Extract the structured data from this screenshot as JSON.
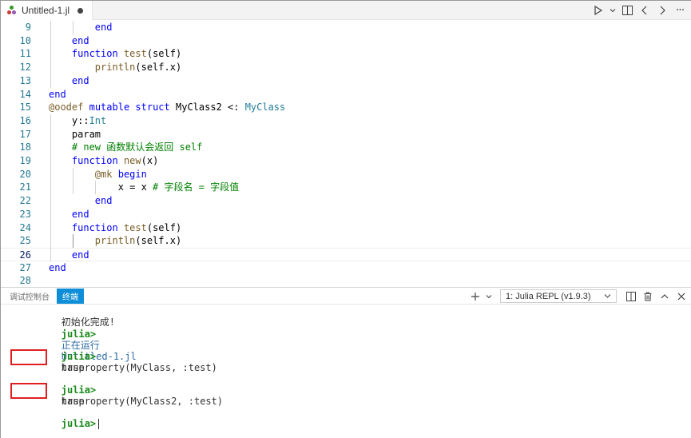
{
  "tab": {
    "filename": "Untitled-1.jl"
  },
  "editor": {
    "lines": [
      {
        "num": "9",
        "segments": [
          {
            "t": "        "
          },
          {
            "t": "end",
            "c": "kw"
          }
        ]
      },
      {
        "num": "10",
        "segments": [
          {
            "t": "    "
          },
          {
            "t": "end",
            "c": "kw"
          }
        ]
      },
      {
        "num": "11",
        "segments": [
          {
            "t": "    "
          },
          {
            "t": "function",
            "c": "kw"
          },
          {
            "t": " "
          },
          {
            "t": "test",
            "c": "fn"
          },
          {
            "t": "(self)"
          }
        ]
      },
      {
        "num": "12",
        "segments": [
          {
            "t": "        "
          },
          {
            "t": "println",
            "c": "fn"
          },
          {
            "t": "(self.x)"
          }
        ]
      },
      {
        "num": "13",
        "segments": [
          {
            "t": "    "
          },
          {
            "t": "end",
            "c": "kw"
          }
        ]
      },
      {
        "num": "14",
        "segments": [
          {
            "t": "end",
            "c": "kw"
          }
        ]
      },
      {
        "num": "15",
        "segments": [
          {
            "t": "@oodef",
            "c": "mc"
          },
          {
            "t": " "
          },
          {
            "t": "mutable",
            "c": "kw"
          },
          {
            "t": " "
          },
          {
            "t": "struct",
            "c": "kw"
          },
          {
            "t": " MyClass2 <: "
          },
          {
            "t": "MyClass",
            "c": "ty"
          }
        ]
      },
      {
        "num": "16",
        "segments": [
          {
            "t": "    y::"
          },
          {
            "t": "Int",
            "c": "ty"
          }
        ]
      },
      {
        "num": "17",
        "segments": [
          {
            "t": "    param"
          }
        ]
      },
      {
        "num": "18",
        "segments": [
          {
            "t": "    "
          },
          {
            "t": "# new 函数默认会返回 self",
            "c": "cm"
          }
        ]
      },
      {
        "num": "19",
        "segments": [
          {
            "t": "    "
          },
          {
            "t": "function",
            "c": "kw"
          },
          {
            "t": " "
          },
          {
            "t": "new",
            "c": "fn"
          },
          {
            "t": "(x)"
          }
        ]
      },
      {
        "num": "20",
        "segments": [
          {
            "t": "        "
          },
          {
            "t": "@mk",
            "c": "mc"
          },
          {
            "t": " "
          },
          {
            "t": "begin",
            "c": "kw"
          }
        ]
      },
      {
        "num": "21",
        "segments": [
          {
            "t": "            x = x "
          },
          {
            "t": "# 字段名 = 字段值",
            "c": "cm"
          }
        ]
      },
      {
        "num": "22",
        "segments": [
          {
            "t": "        "
          },
          {
            "t": "end",
            "c": "kw"
          }
        ]
      },
      {
        "num": "23",
        "segments": [
          {
            "t": "    "
          },
          {
            "t": "end",
            "c": "kw"
          }
        ]
      },
      {
        "num": "24",
        "segments": [
          {
            "t": "    "
          },
          {
            "t": "function",
            "c": "kw"
          },
          {
            "t": " "
          },
          {
            "t": "test",
            "c": "fn"
          },
          {
            "t": "(self)"
          }
        ]
      },
      {
        "num": "25",
        "segments": [
          {
            "t": "        "
          },
          {
            "t": "println",
            "c": "fn"
          },
          {
            "t": "(self.x)"
          }
        ]
      },
      {
        "num": "26",
        "segments": [
          {
            "t": "    "
          },
          {
            "t": "end",
            "c": "kw"
          }
        ]
      },
      {
        "num": "27",
        "segments": [
          {
            "t": "end",
            "c": "kw"
          }
        ]
      },
      {
        "num": "28",
        "segments": []
      }
    ]
  },
  "panel": {
    "tabs": [
      "调试控制台",
      "终端"
    ],
    "terminal_select": "1: Julia REPL (v1.9.3)",
    "icons": [
      "plus-icon",
      "chevron-down-icon",
      "split-icon",
      "trash-icon",
      "chevron-up-icon",
      "close-icon"
    ]
  },
  "terminal": {
    "init_done": "初始化完成!",
    "prompt": "julia>",
    "running_text": "正在运行",
    "running_file": "Untitled-1.jl",
    "cmd1": "hasproperty(MyClass, :test)",
    "out1": "true",
    "cmd2": "hasproperty(MyClass2, :test)",
    "out2": "true"
  },
  "colors": {
    "active_tab": "#0e8ed8",
    "prompt_green": "#1a8a1a",
    "highlight_box": "#e02020"
  }
}
